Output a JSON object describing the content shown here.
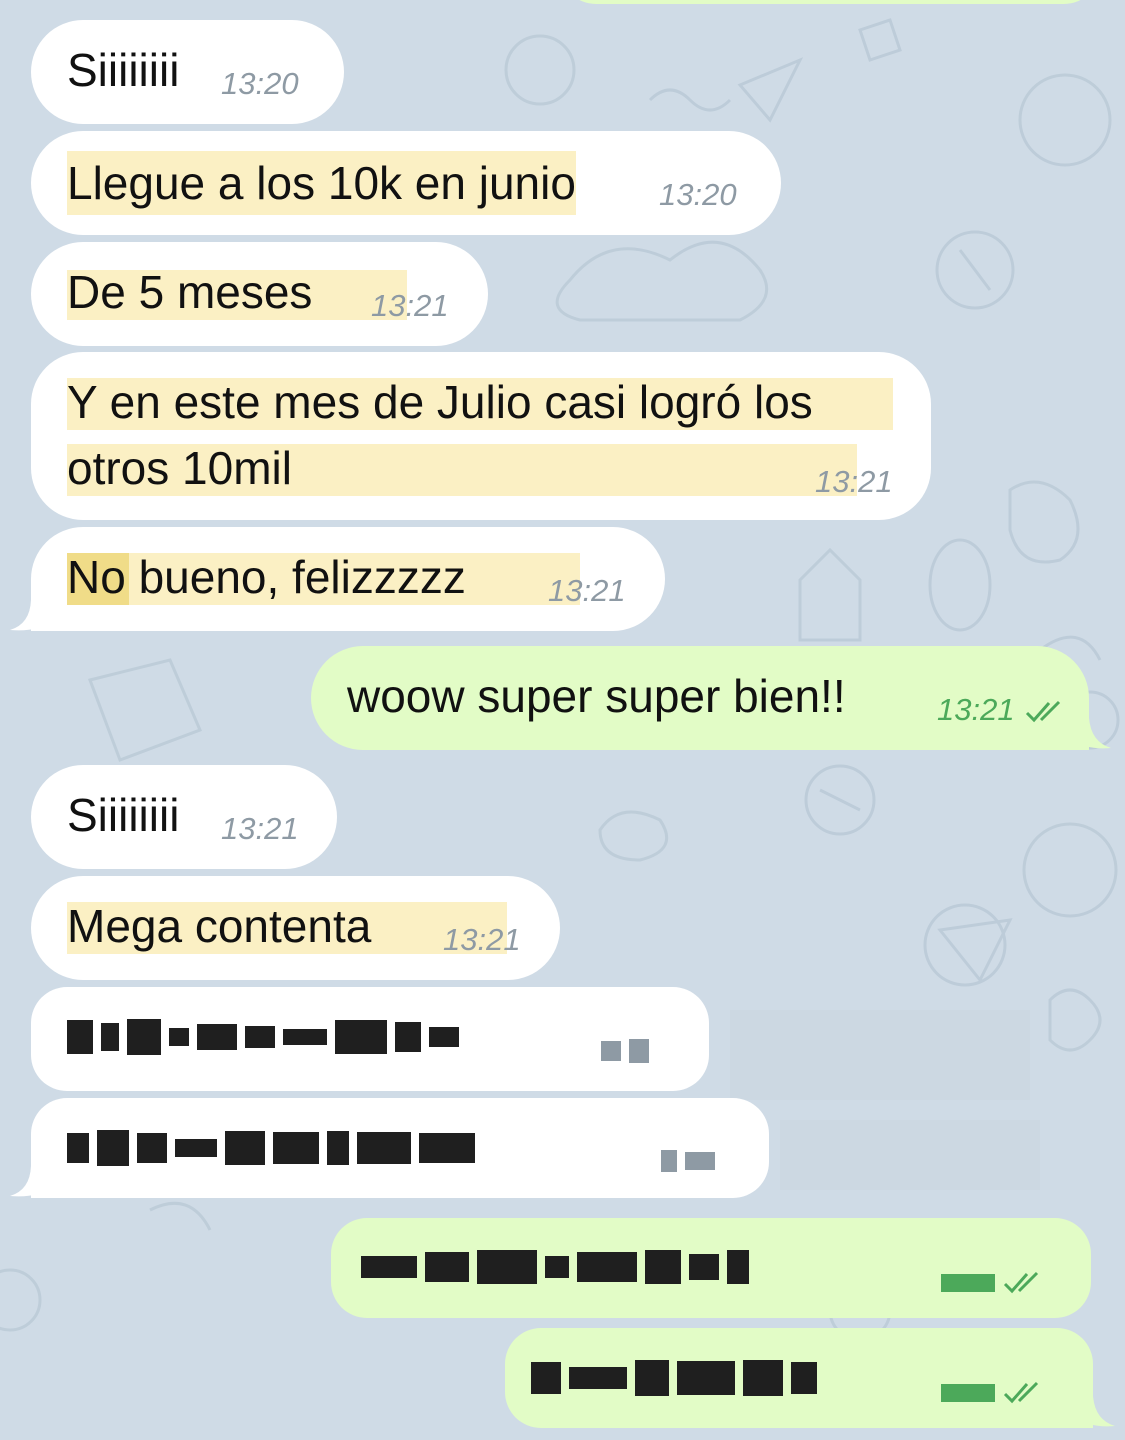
{
  "theme": {
    "chat_bg": "#cfdbe6",
    "incoming_bg": "#ffffff",
    "outgoing_bg": "#e2fcc6",
    "highlight": "#fbf0c4",
    "time_in": "#8e9aa4",
    "time_out": "#4ca95a"
  },
  "messages": [
    {
      "direction": "in",
      "text": "Siiiiiiii",
      "time": "13:20"
    },
    {
      "direction": "in",
      "text": "Llegue a los 10k en junio",
      "time": "13:20"
    },
    {
      "direction": "in",
      "text": "De 5 meses",
      "time": "13:21"
    },
    {
      "direction": "in",
      "text_line1": "Y en este mes de Julio casi logró los",
      "text_line2": "otros 10mil",
      "time": "13:21"
    },
    {
      "direction": "in",
      "text": "No bueno, felizzzzz",
      "time": "13:21"
    },
    {
      "direction": "out",
      "text": "woow super super bien!!",
      "time": "13:21",
      "status_icon": "double-check-icon"
    },
    {
      "direction": "in",
      "text": "Siiiiiiii",
      "time": "13:21"
    },
    {
      "direction": "in",
      "text": "Mega contenta",
      "time": "13:21"
    },
    {
      "direction": "in",
      "text": "",
      "time": "",
      "pixelated": true
    },
    {
      "direction": "in",
      "text": "",
      "time": "",
      "pixelated": true
    },
    {
      "direction": "out",
      "text": "",
      "time": "",
      "pixelated": true,
      "status_icon": "double-check-icon"
    },
    {
      "direction": "out",
      "text": "",
      "time": "",
      "pixelated": true,
      "status_icon": "double-check-icon"
    }
  ]
}
